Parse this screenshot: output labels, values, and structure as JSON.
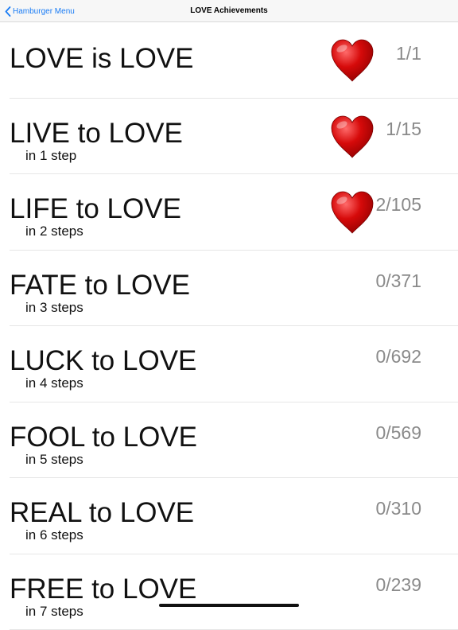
{
  "navbar": {
    "back_label": "Hamburger Menu",
    "title": "LOVE Achievements"
  },
  "rows": [
    {
      "title": "LOVE is LOVE",
      "subtitle": "",
      "count": "1/1",
      "achieved": true
    },
    {
      "title": "LIVE to LOVE",
      "subtitle": "in 1 step",
      "count": "1/15",
      "achieved": true
    },
    {
      "title": "LIFE to LOVE",
      "subtitle": "in 2 steps",
      "count": "2/105",
      "achieved": true
    },
    {
      "title": "FATE to LOVE",
      "subtitle": "in 3 steps",
      "count": "0/371",
      "achieved": false
    },
    {
      "title": "LUCK to LOVE",
      "subtitle": "in 4 steps",
      "count": "0/692",
      "achieved": false
    },
    {
      "title": "FOOL to LOVE",
      "subtitle": "in 5 steps",
      "count": "0/569",
      "achieved": false
    },
    {
      "title": "REAL to LOVE",
      "subtitle": "in 6 steps",
      "count": "0/310",
      "achieved": false
    },
    {
      "title": "FREE to LOVE",
      "subtitle": "in 7 steps",
      "count": "0/239",
      "achieved": false
    }
  ],
  "colors": {
    "accent": "#1a7cf5",
    "heart": "#d60a0a",
    "count_text": "#8a8a8a"
  },
  "icons": {
    "back": "chevron-left-icon",
    "achievement": "heart-icon"
  }
}
